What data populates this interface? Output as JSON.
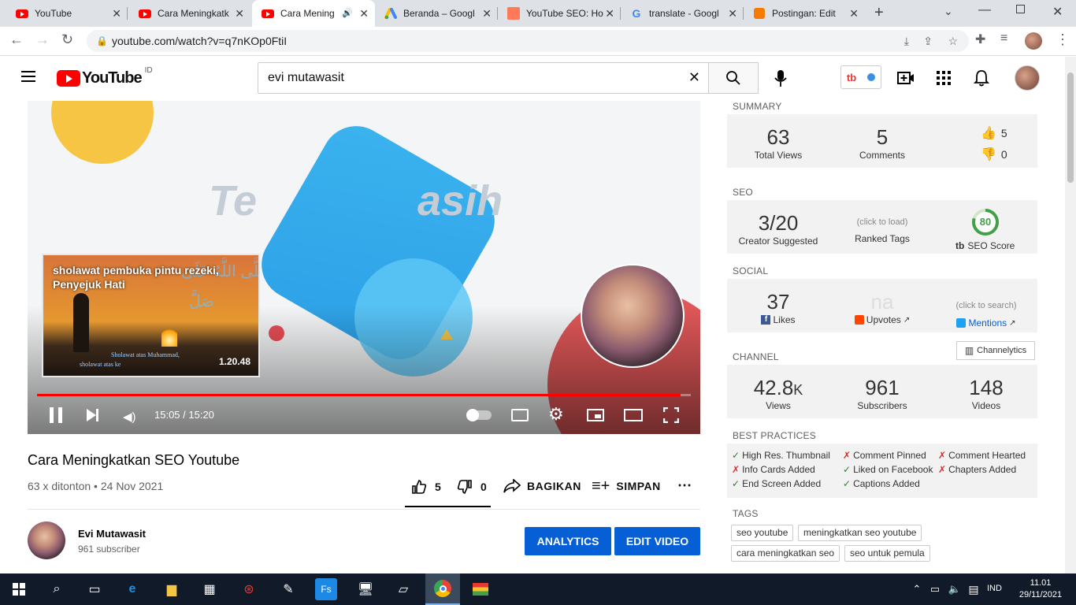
{
  "browser": {
    "tabs": [
      {
        "title": "YouTube",
        "icon": "youtube-icon"
      },
      {
        "title": "Cara Meningkatk",
        "icon": "youtube-icon"
      },
      {
        "title": "Cara Mening",
        "icon": "youtube-icon",
        "active": true
      },
      {
        "title": "Beranda – Googl",
        "icon": "google-ads-icon"
      },
      {
        "title": "YouTube SEO: Ho",
        "icon": "hubspot-icon"
      },
      {
        "title": "translate - Googl",
        "icon": "google-icon"
      },
      {
        "title": "Postingan: Edit",
        "icon": "blogger-icon"
      }
    ],
    "url": "youtube.com/watch?v=q7nKOp0FtiI"
  },
  "youtube": {
    "logo_text": "YouTube",
    "region": "ID",
    "search_value": "evi mutawasit"
  },
  "player": {
    "overlay_text": "Te",
    "overlay_text2": "asih",
    "endcard_title": "sholawat pembuka pintu rezeki, Penyejuk Hati",
    "endcard_duration": "1.20.48",
    "endcard_arabic": "صَلَّى اللَّهُ عَلَى",
    "endcard_arabic2": "صَلَّ",
    "endcard_caption1": "Sholawat atas Muhammad,",
    "endcard_caption2": "sholawat atas ke",
    "time": "15:05 / 15:20",
    "progress": 0.984
  },
  "video": {
    "title": "Cara Meningkatkan SEO Youtube",
    "meta": "63 x ditonton • 24 Nov 2021",
    "likes": "5",
    "dislikes": "0",
    "share_label": "BAGIKAN",
    "save_label": "SIMPAN",
    "channel_name": "Evi Mutawasit",
    "subscribers": "961 subscriber",
    "analytics_label": "ANALYTICS",
    "edit_label": "EDIT VIDEO"
  },
  "tubebuddy": {
    "summary_label": "SUMMARY",
    "total_views": "63",
    "total_views_label": "Total Views",
    "comments": "5",
    "comments_label": "Comments",
    "likes": "5",
    "dislikes": "0",
    "seo_label": "SEO",
    "creator_suggested": "3/20",
    "creator_suggested_label": "Creator Suggested",
    "ranked_tags_hint": "(click to load)",
    "ranked_tags_label": "Ranked Tags",
    "seo_score": "80",
    "seo_score_label": "SEO Score",
    "social_label": "SOCIAL",
    "fb_likes": "37",
    "fb_likes_label": "Likes",
    "upvotes": "na",
    "upvotes_label": "Upvotes",
    "mentions_hint": "(click to search)",
    "mentions_label": "Mentions",
    "channelytics_label": "Channelytics",
    "channel_label": "CHANNEL",
    "views_num": "42.8",
    "views_suffix": "K",
    "views_label": "Views",
    "subs": "961",
    "subs_label": "Subscribers",
    "videos": "148",
    "videos_label": "Videos",
    "bp_label": "BEST PRACTICES",
    "best_practices": [
      {
        "mark": "✓",
        "text": "High Res. Thumbnail",
        "ok": true
      },
      {
        "mark": "✗",
        "text": "Comment Pinned",
        "ok": false
      },
      {
        "mark": "✗",
        "text": "Comment Hearted",
        "ok": false
      },
      {
        "mark": "✗",
        "text": "Info Cards Added",
        "ok": false
      },
      {
        "mark": "✓",
        "text": "Liked on Facebook",
        "ok": true
      },
      {
        "mark": "✗",
        "text": "Chapters Added",
        "ok": false
      },
      {
        "mark": "✓",
        "text": "End Screen Added",
        "ok": true
      },
      {
        "mark": "✓",
        "text": "Captions Added",
        "ok": true
      }
    ],
    "tags_label": "TAGS",
    "tags": [
      "seo youtube",
      "meningkatkan seo youtube",
      "cara meningkatkan seo",
      "seo untuk pemula"
    ]
  },
  "taskbar": {
    "lang": "IND",
    "time": "11.01",
    "date": "29/11/2021"
  }
}
